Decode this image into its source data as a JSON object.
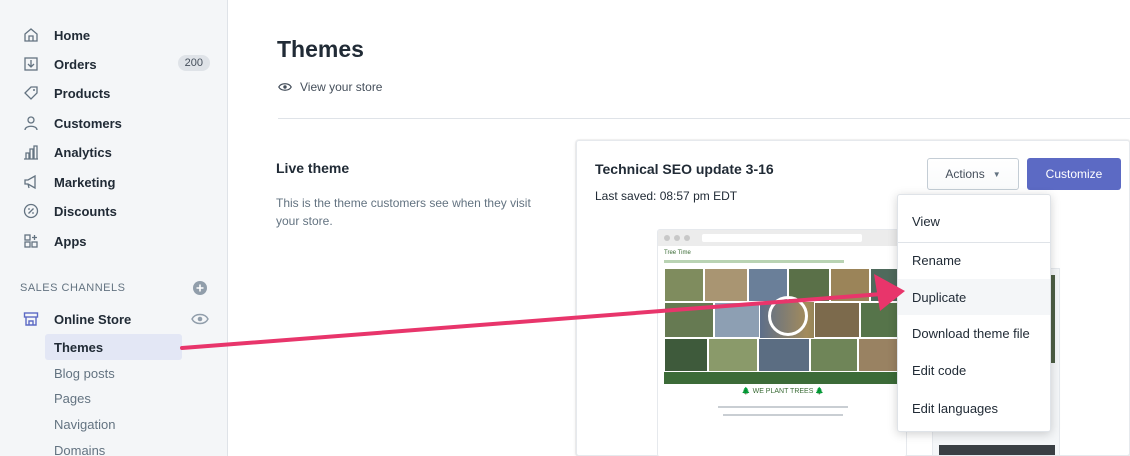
{
  "sidebar": {
    "items": [
      {
        "label": "Home",
        "icon": "home-icon"
      },
      {
        "label": "Orders",
        "icon": "orders-icon",
        "badge": "200"
      },
      {
        "label": "Products",
        "icon": "tag-icon"
      },
      {
        "label": "Customers",
        "icon": "person-icon"
      },
      {
        "label": "Analytics",
        "icon": "bar-chart-icon"
      },
      {
        "label": "Marketing",
        "icon": "megaphone-icon"
      },
      {
        "label": "Discounts",
        "icon": "discount-icon"
      },
      {
        "label": "Apps",
        "icon": "apps-icon"
      }
    ],
    "sales_channels_title": "SALES CHANNELS",
    "online_store": {
      "label": "Online Store",
      "icon": "store-icon"
    },
    "sub_items": [
      "Themes",
      "Blog posts",
      "Pages",
      "Navigation",
      "Domains"
    ]
  },
  "main": {
    "title": "Themes",
    "view_store": "View your store",
    "live_theme": {
      "title": "Live theme",
      "description": "This is the theme customers see when they visit your store."
    },
    "card": {
      "theme_name": "Technical SEO update 3-16",
      "last_saved": "Last saved: 08:57 pm EDT",
      "actions_label": "Actions",
      "customize_label": "Customize",
      "preview": {
        "logo_text": "Tree Time",
        "trees_text": "🌲 WE PLANT TREES 🌲"
      }
    },
    "actions_menu": [
      "View",
      "Rename",
      "Duplicate",
      "Download theme file",
      "Edit code",
      "Edit languages"
    ]
  },
  "colors": {
    "accent": "#5c6ac4",
    "arrow": "#e8356b",
    "sidebar_bg": "#f4f6f8",
    "active_bg": "#e3e7f5"
  }
}
